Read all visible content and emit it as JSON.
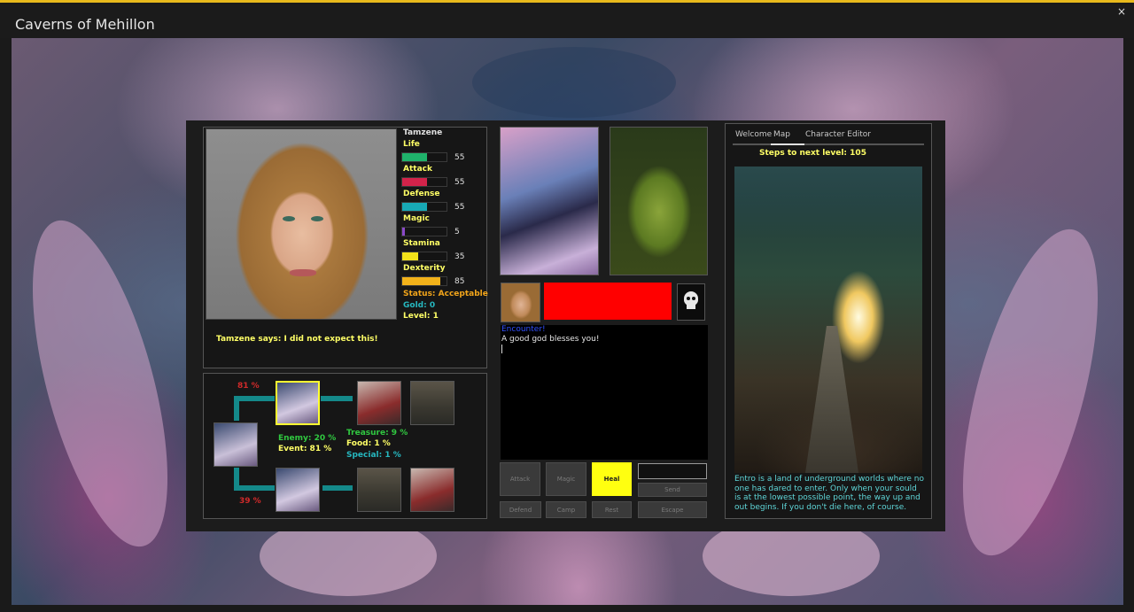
{
  "window": {
    "title": "Caverns of Mehillon",
    "close_glyph": "×"
  },
  "character": {
    "name": "Tamzene",
    "stats": [
      {
        "label": "Life",
        "value": 55,
        "max": 100,
        "color": "#1fb36b"
      },
      {
        "label": "Attack",
        "value": 55,
        "max": 100,
        "color": "#d2234a"
      },
      {
        "label": "Defense",
        "value": 55,
        "max": 100,
        "color": "#18a9b6"
      },
      {
        "label": "Magic",
        "value": 5,
        "max": 100,
        "color": "#8b49c8"
      },
      {
        "label": "Stamina",
        "value": 35,
        "max": 100,
        "color": "#f2e21a"
      },
      {
        "label": "Dexterity",
        "value": 85,
        "max": 100,
        "color": "#f2b21a"
      }
    ],
    "status": "Status: Acceptable",
    "gold": "Gold: 0",
    "level": "Level: 1",
    "says": "Tamzene says: I did not expect this!"
  },
  "path_map": {
    "top_percent": "81 %",
    "bottom_percent": "39 %",
    "enemy": "Enemy: 20 %",
    "event": "Event: 81 %",
    "treasure": "Treasure: 9 %",
    "food": "Food: 1 %",
    "special": "Special: 1 %"
  },
  "encounter": {
    "heading": "Encounter!",
    "message": "A good god blesses you!"
  },
  "actions": {
    "attack": "Attack",
    "magic": "Magic",
    "heal": "Heal",
    "send": "Send",
    "defend": "Defend",
    "camp": "Camp",
    "rest": "Rest",
    "escape": "Escape"
  },
  "side": {
    "tabs": [
      "Welcome",
      "Map",
      "Character Editor"
    ],
    "active_tab": "Map",
    "steps": "Steps to next level: 105",
    "description": "Entro is a land of underground worlds where no one has dared to enter. Only when your sould is at the lowest possible point, the way up and out begins. If you don't die here, of course."
  },
  "icons": {
    "enemy": "skull-icon"
  }
}
